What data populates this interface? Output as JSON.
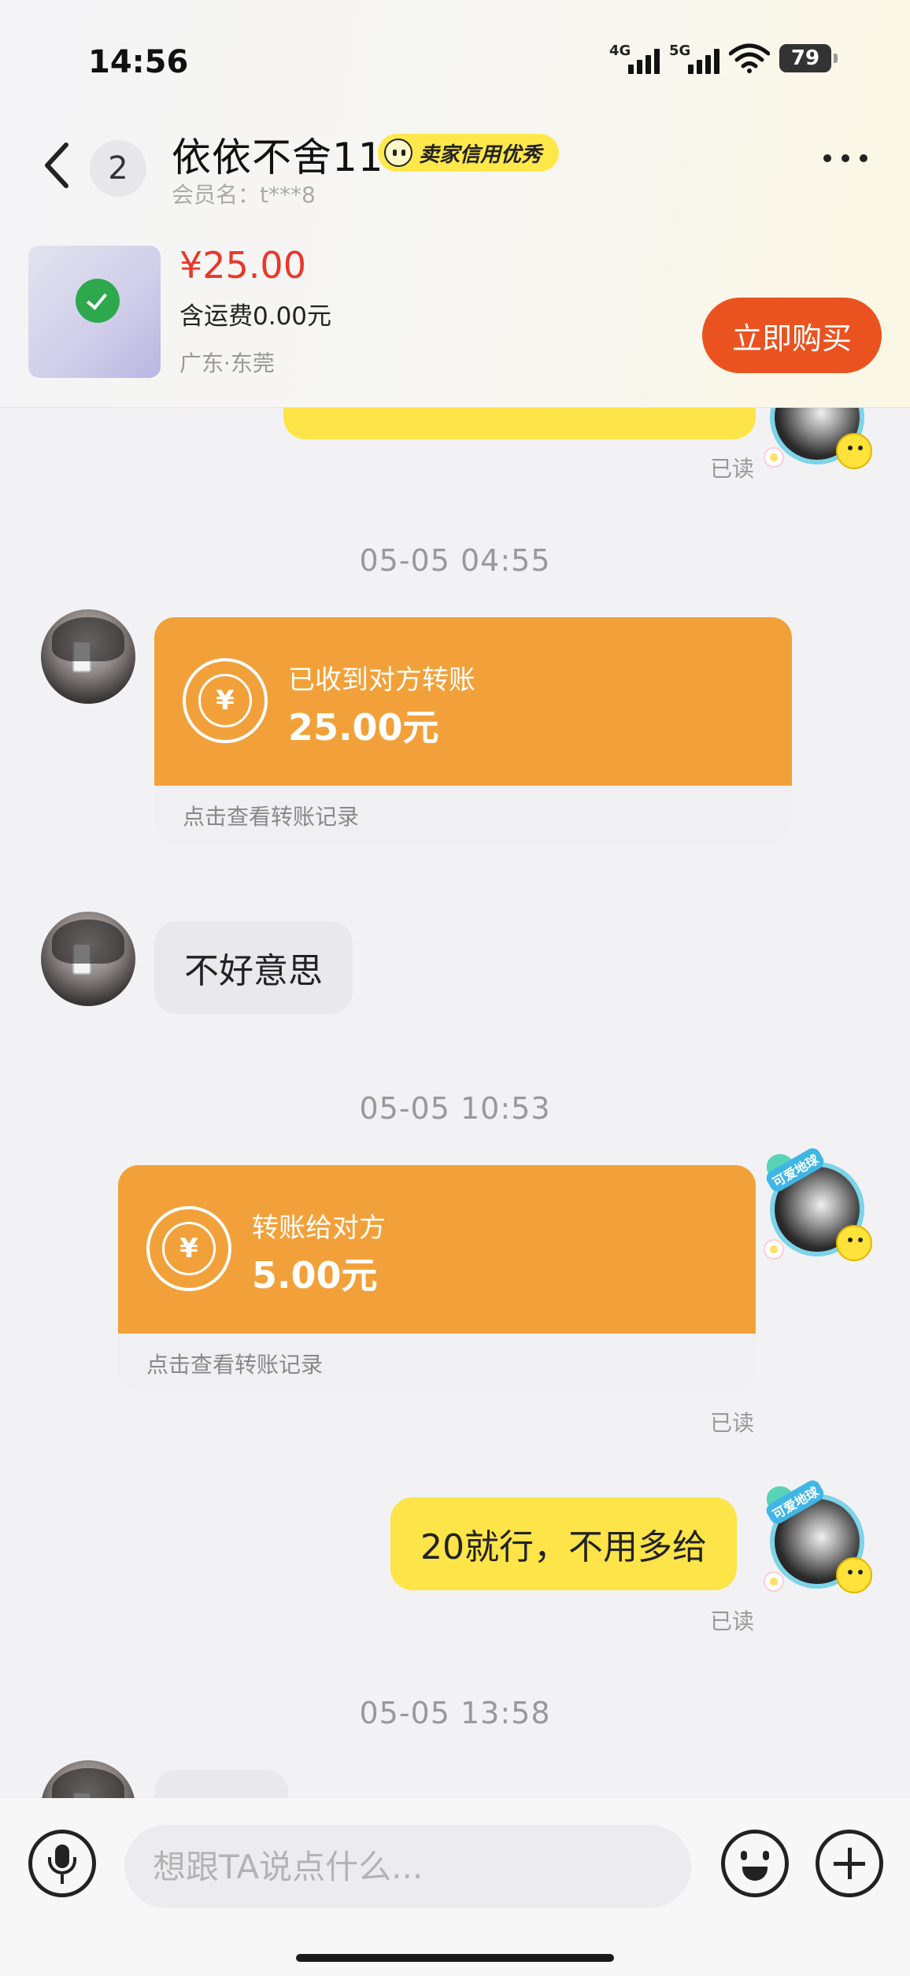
{
  "status_bar": {
    "time": "14:56",
    "network_1": "4G",
    "network_2": "5G",
    "battery": "79"
  },
  "header": {
    "unread_count": "2",
    "seller_name": "依依不舍11",
    "credit_badge": "卖家信用优秀",
    "member_name": "会员名：t***8",
    "more_icon": "more-horizontal-icon"
  },
  "product": {
    "price": "¥25.00",
    "shipping": "含运费0.00元",
    "location": "广东·东莞",
    "buy_label": "立即购买"
  },
  "messages": {
    "read_label": "已读",
    "time_1": "05-05 04:55",
    "transfer_received": {
      "label": "已收到对方转账",
      "amount": "25.00元",
      "footer": "点击查看转账记录"
    },
    "text_in_1": "不好意思",
    "time_2": "05-05 10:53",
    "transfer_sent": {
      "label": "转账给对方",
      "amount": "5.00元",
      "footer": "点击查看转账记录"
    },
    "text_out_1": "20就行，不用多给",
    "time_3": "05-05 13:58",
    "avatar_tag": "可爱地球"
  },
  "input_bar": {
    "placeholder": "想跟TA说点什么...",
    "voice_icon": "microphone-icon",
    "emoji_icon": "emoji-icon",
    "plus_icon": "plus-icon"
  },
  "colors": {
    "accent_yellow": "#fde448",
    "transfer_orange": "#f2a13a",
    "buy_button": "#ea5320",
    "price_red": "#e8382a"
  }
}
